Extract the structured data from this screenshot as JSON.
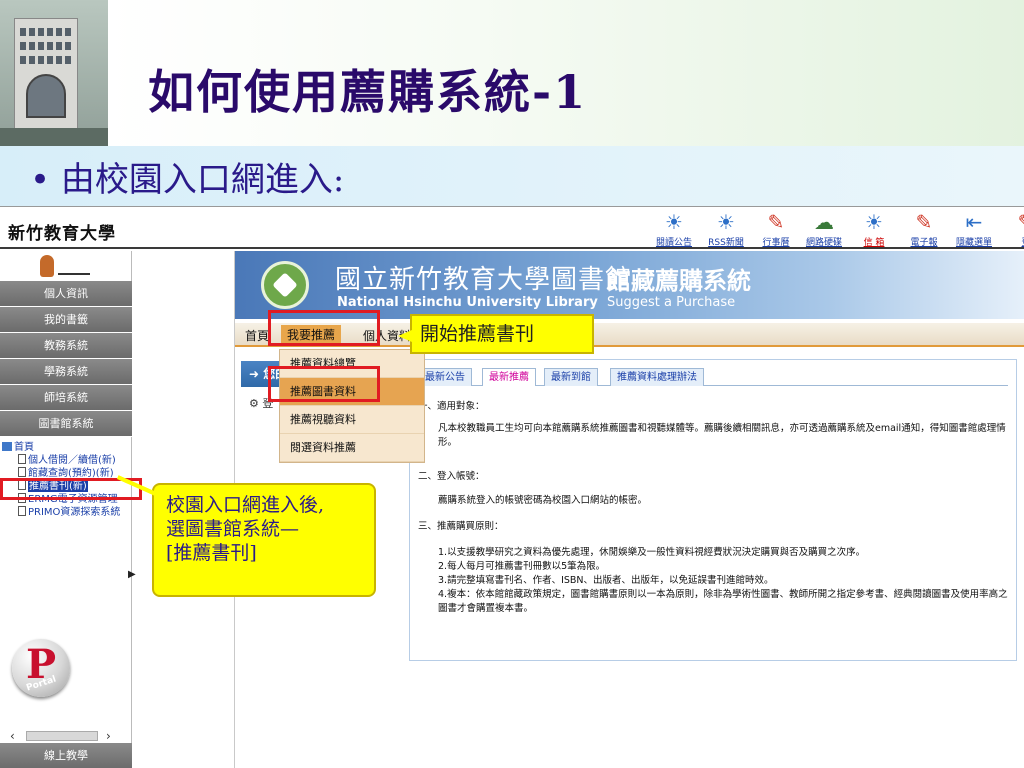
{
  "slide": {
    "title": "如何使用薦購系統-1",
    "bullet": "• 由校園入口網進入:"
  },
  "portal": {
    "name": "新竹教育大學",
    "toolbar": [
      {
        "label": "閱讀公告",
        "icon": "read-announcement-icon",
        "glyph": "☀"
      },
      {
        "label": "RSS新聞",
        "icon": "rss-news-icon",
        "glyph": "☀"
      },
      {
        "label": "行事曆",
        "icon": "calendar-icon",
        "glyph": "✎"
      },
      {
        "label": "網路硬碟",
        "icon": "network-drive-icon",
        "glyph": "☁"
      },
      {
        "label": "信 箱",
        "icon": "mailbox-icon",
        "glyph": "☀"
      },
      {
        "label": "電子報",
        "icon": "newsletter-icon",
        "glyph": "✎"
      },
      {
        "label": "隱藏選單",
        "icon": "hide-menu-icon",
        "glyph": "⇤"
      },
      {
        "label": "登",
        "icon": "logout-icon",
        "glyph": "✎"
      }
    ],
    "sidebar": {
      "menu": [
        "個人資訊",
        "我的書籤",
        "教務系統",
        "學務系統",
        "師培系統",
        "圖書館系統"
      ],
      "tree_root": "首頁",
      "tree_items": [
        "個人借閱／續借(新)",
        "館藏查詢(預約)(新)",
        "推薦書刊(新)",
        "ERMG電子資源管理",
        "PRIMO資源探索系統"
      ],
      "portal_logo": "Portal",
      "bottom": "線上教學",
      "arrow_left": "‹",
      "arrow_right": "›"
    }
  },
  "library": {
    "name_zh": "國立新竹教育大學圖書館",
    "name_en": "National Hsinchu University Library",
    "system_zh": "館藏薦購系統",
    "system_en": "Suggest a Purchase",
    "nav": [
      "首頁",
      "我要推薦",
      "個人資料"
    ],
    "left_tab": "您的...",
    "left_tab2": "登",
    "dropdown": [
      "推薦資料總覽",
      "推薦圖書資料",
      "推薦視聽資料",
      "閱選資料推薦"
    ],
    "tabs": [
      "最新公告",
      "最新推薦",
      "最新到館",
      "推薦資料處理辦法"
    ],
    "article": {
      "h1": "一、適用對象：",
      "p1": "凡本校教職員工生均可向本館薦購系統推薦圖書和視聽媒體等。薦購後續相關訊息，亦可透過薦購系統及email通知，得知圖書館處理情形。",
      "h2": "二、登入帳號：",
      "p2": "薦購系統登入的帳號密碼為校園入口網站的帳密。",
      "h3": "三、推薦購買原則：",
      "rules": [
        "1.以支援教學研究之資料為優先處理，休閒娛樂及一般性資料視經費狀況決定購買與否及購買之次序。",
        "2.每人每月可推薦書刊冊數以5筆為限。",
        "3.請完整填寫書刊名、作者、ISBN、出版者、出版年，以免延誤書刊進館時效。",
        "4.複本：依本館館藏政策規定，圖書館購書原則以一本為原則，除非為學術性圖書、教師所開之指定參考書、經典閱讀圖書及使用率高之圖書才會購置複本書。"
      ]
    }
  },
  "annotations": {
    "top_callout": "開始推薦書刊",
    "side_callout": [
      "校園入口網進入後,",
      "選圖書館系統—",
      "[推薦書刊]"
    ],
    "colors": {
      "callout": "#ffff00",
      "highlight_box": "#e11b22",
      "title": "#2a0a6a"
    }
  }
}
